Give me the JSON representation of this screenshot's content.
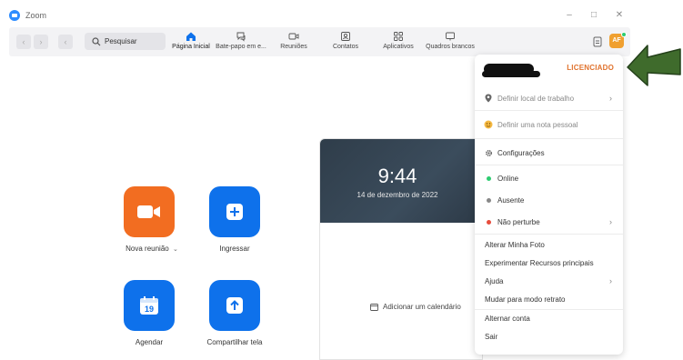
{
  "window": {
    "title": "Zoom"
  },
  "toolbar": {
    "search_label": "Pesquisar",
    "tabs": [
      {
        "label": "Página Inicial",
        "icon": "home-icon"
      },
      {
        "label": "Bate-papo em e...",
        "icon": "chat-icon"
      },
      {
        "label": "Reuniões",
        "icon": "video-icon"
      },
      {
        "label": "Contatos",
        "icon": "contacts-icon"
      },
      {
        "label": "Aplicativos",
        "icon": "apps-icon"
      },
      {
        "label": "Quadros brancos",
        "icon": "whiteboard-icon"
      }
    ],
    "avatar_initials": "AF"
  },
  "tiles": [
    {
      "label": "Nova reunião",
      "icon": "video-camera-icon",
      "color": "#f26d21",
      "has_dropdown": true
    },
    {
      "label": "Ingressar",
      "icon": "plus-icon",
      "color": "#0e71eb"
    },
    {
      "label": "Agendar",
      "icon": "calendar-icon",
      "color": "#0e71eb",
      "calendar_day": "19"
    },
    {
      "label": "Compartilhar tela",
      "icon": "share-up-icon",
      "color": "#0e71eb"
    }
  ],
  "calendar": {
    "time": "9:44",
    "date": "14 de dezembro de 2022",
    "add_calendar_label": "Adicionar um calendário"
  },
  "menu": {
    "license": "LICENCIADO",
    "license_color": "#e0722d",
    "set_location": "Definir local de trabalho",
    "set_note": "Definir uma nota pessoal",
    "settings": "Configurações",
    "status_online": "Online",
    "status_away": "Ausente",
    "status_dnd": "Não perturbe",
    "change_photo": "Alterar Minha Foto",
    "try_features": "Experimentar Recursos principais",
    "help": "Ajuda",
    "portrait_mode": "Mudar para modo retrato",
    "switch_account": "Alternar conta",
    "sign_out": "Sair",
    "status_colors": {
      "online": "#2ecc71",
      "away": "#888888",
      "dnd": "#e74c3c"
    }
  },
  "annotation": {
    "arrow_color": "#3a5a2c"
  }
}
